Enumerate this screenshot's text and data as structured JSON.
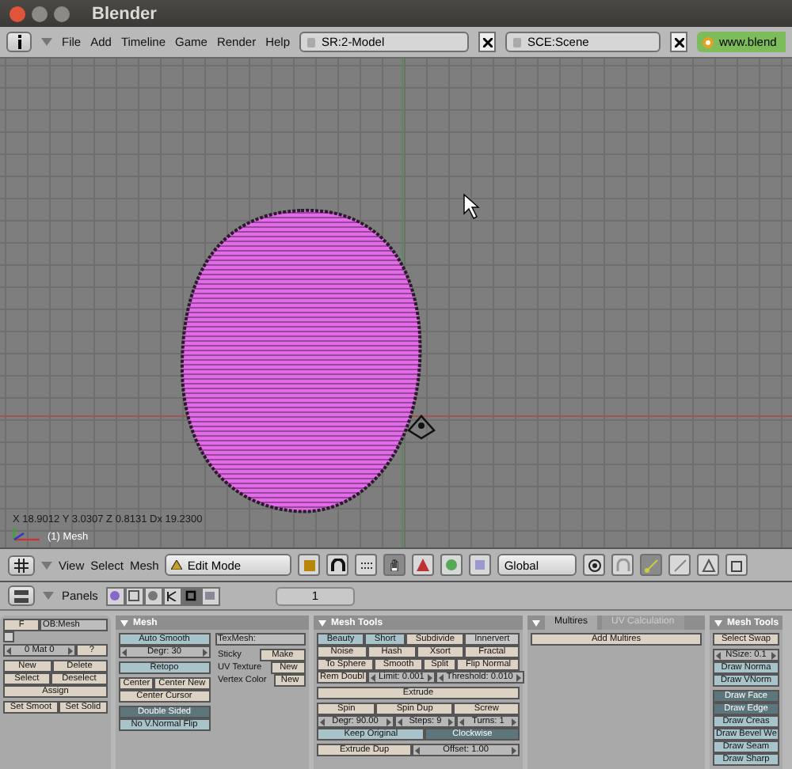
{
  "window": {
    "title": "Blender"
  },
  "menu_bar": {
    "menus": [
      "File",
      "Add",
      "Timeline",
      "Game",
      "Render",
      "Help"
    ],
    "screen": "SR:2-Model",
    "scene": "SCE:Scene",
    "website": "www.blend"
  },
  "viewport": {
    "coordinates": "X 18.9012  Y 3.0307  Z 0.8131  Dx 19.2300",
    "object_label": "(1) Mesh"
  },
  "view3d_header": {
    "menus": [
      "View",
      "Select",
      "Mesh"
    ],
    "mode": "Edit Mode",
    "orientation": "Global",
    "select_modes": [
      {
        "selected": true
      },
      {
        "selected": false
      },
      {
        "selected": false
      },
      {
        "selected": false
      }
    ]
  },
  "buttons_header": {
    "label": "Panels",
    "tabs": [
      {
        "selected": false
      },
      {
        "selected": false
      },
      {
        "selected": false
      },
      {
        "selected": false
      },
      {
        "selected": true
      },
      {
        "selected": false
      }
    ],
    "frame": "1"
  },
  "panels": [
    {
      "columns": [
        [
          [
            [
              {
                "kind": "button",
                "label": "F"
              },
              {
                "kind": "field",
                "label": "OB:Mesh"
              }
            ],
            [
              {
                "kind": "swatch"
              }
            ],
            [
              {
                "kind": "number",
                "label": "0 Mat 0"
              },
              {
                "kind": "button",
                "label": "?"
              }
            ]
          ],
          [
            [
              {
                "kind": "button",
                "label": "New"
              },
              {
                "kind": "button",
                "label": "Delete"
              }
            ],
            [
              {
                "kind": "button",
                "label": "Select"
              },
              {
                "kind": "button",
                "label": "Deselect"
              }
            ],
            [
              {
                "kind": "button",
                "label": "Assign"
              }
            ]
          ],
          [
            [
              {
                "kind": "button",
                "label": "Set Smoot"
              },
              {
                "kind": "button",
                "label": "Set Solid"
              }
            ]
          ]
        ]
      ]
    },
    {
      "title": "Mesh",
      "columns": [
        [
          [
            [
              {
                "kind": "toggle",
                "label": "Auto Smooth",
                "on": false
              }
            ],
            [
              {
                "kind": "number",
                "label": "Degr: 30"
              }
            ]
          ],
          [
            [
              {
                "kind": "toggle",
                "label": "Retopo",
                "on": false
              }
            ]
          ],
          [
            [
              {
                "kind": "button",
                "label": "Center"
              },
              {
                "kind": "button",
                "label": "Center New"
              }
            ],
            [
              {
                "kind": "button",
                "label": "Center Cursor"
              }
            ]
          ],
          [
            [
              {
                "kind": "toggle",
                "label": "Double Sided",
                "on": true
              }
            ],
            [
              {
                "kind": "toggle",
                "label": "No V.Normal Flip",
                "on": false
              }
            ]
          ]
        ],
        [
          [
            [
              {
                "kind": "field",
                "label": "TexMesh:"
              }
            ]
          ],
          [
            [
              {
                "kind": "label",
                "label": "Sticky"
              },
              {
                "kind": "button",
                "label": "Make"
              }
            ],
            [
              {
                "kind": "label",
                "label": "UV Texture"
              },
              {
                "kind": "button",
                "label": "New"
              }
            ],
            [
              {
                "kind": "label",
                "label": "Vertex Color"
              },
              {
                "kind": "button",
                "label": "New"
              }
            ]
          ]
        ]
      ]
    },
    {
      "title": "Mesh Tools",
      "columns": [
        [
          [
            [
              {
                "kind": "toggle",
                "label": "Beauty",
                "on": false
              },
              {
                "kind": "toggle",
                "label": "Short",
                "on": false
              },
              {
                "kind": "button",
                "label": "Subdivide"
              },
              {
                "kind": "menu",
                "label": "Innervert"
              }
            ],
            [
              {
                "kind": "button",
                "label": "Noise"
              },
              {
                "kind": "button",
                "label": "Hash"
              },
              {
                "kind": "button",
                "label": "Xsort"
              },
              {
                "kind": "button",
                "label": "Fractal"
              }
            ],
            [
              {
                "kind": "button",
                "label": "To Sphere"
              },
              {
                "kind": "button",
                "label": "Smooth"
              },
              {
                "kind": "button",
                "label": "Split"
              },
              {
                "kind": "button",
                "label": "Flip Normal"
              }
            ],
            [
              {
                "kind": "button",
                "label": "Rem Doubl"
              },
              {
                "kind": "number",
                "label": "Limit: 0.001"
              },
              {
                "kind": "number",
                "label": "Threshold: 0.010"
              }
            ]
          ],
          [
            [
              {
                "kind": "button",
                "label": "Extrude"
              }
            ]
          ],
          [
            [
              {
                "kind": "button",
                "label": "Spin"
              },
              {
                "kind": "button",
                "label": "Spin Dup"
              },
              {
                "kind": "button",
                "label": "Screw"
              }
            ],
            [
              {
                "kind": "number",
                "label": "Degr: 90.00"
              },
              {
                "kind": "number",
                "label": "Steps: 9"
              },
              {
                "kind": "number",
                "label": "Turns: 1"
              }
            ],
            [
              {
                "kind": "toggle",
                "label": "Keep Original",
                "on": false
              },
              {
                "kind": "toggle",
                "label": "Clockwise",
                "on": true
              }
            ]
          ],
          [
            [
              {
                "kind": "button",
                "label": "Extrude Dup"
              },
              {
                "kind": "number",
                "label": "Offset: 1.00"
              }
            ]
          ]
        ]
      ]
    },
    {
      "tabs": [
        {
          "label": "Multires",
          "selected": true
        },
        {
          "label": "UV Calculation",
          "selected": false
        }
      ],
      "columns": [
        [
          [
            [
              {
                "kind": "button",
                "label": "Add Multires"
              }
            ]
          ]
        ]
      ]
    },
    {
      "title": "Mesh Tools",
      "columns": [
        [
          [
            [
              {
                "kind": "button",
                "label": "Select Swap"
              }
            ]
          ],
          [
            [
              {
                "kind": "number",
                "label": "NSize: 0.1"
              }
            ],
            [
              {
                "kind": "toggle",
                "label": "Draw Norma",
                "on": false
              }
            ],
            [
              {
                "kind": "toggle",
                "label": "Draw VNorm",
                "on": false
              }
            ]
          ],
          [
            [
              {
                "kind": "toggle",
                "label": "Draw Face",
                "on": true
              }
            ],
            [
              {
                "kind": "toggle",
                "label": "Draw Edge",
                "on": true
              }
            ],
            [
              {
                "kind": "toggle",
                "label": "Draw Creas",
                "on": false
              }
            ],
            [
              {
                "kind": "toggle",
                "label": "Draw Bevel We",
                "on": false
              }
            ],
            [
              {
                "kind": "toggle",
                "label": "Draw Seam",
                "on": false
              }
            ],
            [
              {
                "kind": "toggle",
                "label": "Draw Sharp",
                "on": false
              }
            ]
          ]
        ]
      ]
    }
  ]
}
